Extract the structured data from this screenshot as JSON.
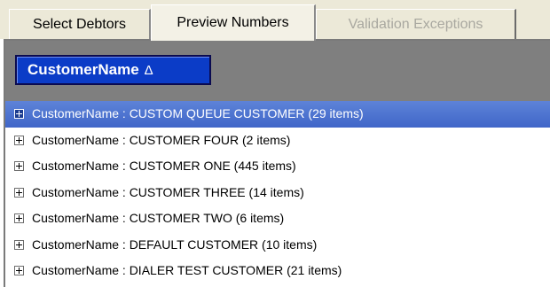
{
  "tabs": [
    {
      "label": "Select Debtors",
      "state": "normal"
    },
    {
      "label": "Preview Numbers",
      "state": "active"
    },
    {
      "label": "Validation Exceptions",
      "state": "disabled"
    }
  ],
  "group_panel": {
    "chip_label": "CustomerName",
    "sort_indicator": "Δ"
  },
  "rows": [
    {
      "label": "CustomerName : CUSTOM QUEUE CUSTOMER (29 items)",
      "selected": true
    },
    {
      "label": "CustomerName : CUSTOMER FOUR (2 items)",
      "selected": false
    },
    {
      "label": "CustomerName : CUSTOMER ONE (445 items)",
      "selected": false
    },
    {
      "label": "CustomerName : CUSTOMER THREE (14 items)",
      "selected": false
    },
    {
      "label": "CustomerName : CUSTOMER TWO (6 items)",
      "selected": false
    },
    {
      "label": "CustomerName : DEFAULT CUSTOMER (10 items)",
      "selected": false
    },
    {
      "label": "CustomerName : DIALER TEST CUSTOMER (21 items)",
      "selected": false
    }
  ],
  "colors": {
    "tab_background": "#ece9d8",
    "group_panel": "#7f7f7f",
    "chip": "#0b3cc7",
    "selected_row": "#4f74d0"
  },
  "icons": {
    "expander": "plus-box-icon"
  }
}
